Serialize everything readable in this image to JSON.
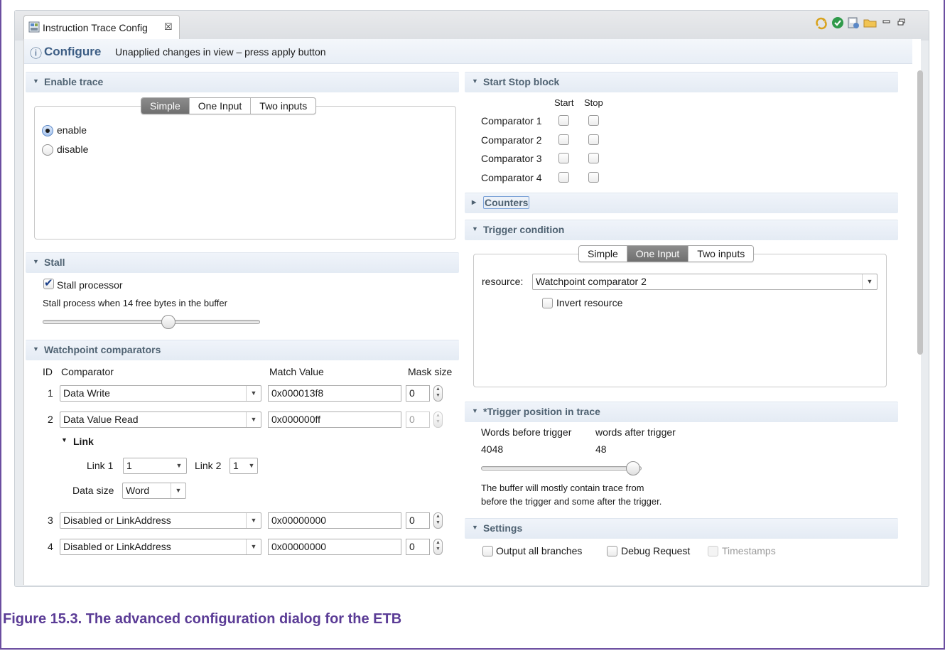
{
  "tab": {
    "title": "Instruction Trace Config",
    "close": "☒"
  },
  "toolbar_icons": [
    "refresh-icon",
    "apply-check-icon",
    "save-icon",
    "open-folder-icon",
    "minimize-icon",
    "maximize-icon"
  ],
  "infobar": {
    "icon": "ⓘ",
    "title": "Configure",
    "message": "Unapplied changes in view – press apply button"
  },
  "enable_trace": {
    "header": "Enable trace",
    "modes": [
      "Simple",
      "One Input",
      "Two inputs"
    ],
    "selected_mode": "Simple",
    "options": [
      "enable",
      "disable"
    ],
    "selected": "enable"
  },
  "stall": {
    "header": "Stall",
    "checkbox_label": "Stall processor",
    "checked": true,
    "description": "Stall process when 14 free bytes in the buffer",
    "slider_fraction": 0.58
  },
  "watchpoints": {
    "header": "Watchpoint comparators",
    "columns": {
      "id": "ID",
      "comparator": "Comparator",
      "match": "Match Value",
      "mask": "Mask size"
    },
    "rows": [
      {
        "id": "1",
        "comparator": "Data Write",
        "match": "0x000013f8",
        "mask": "0",
        "enabled": true
      },
      {
        "id": "2",
        "comparator": "Data Value Read",
        "match": "0x000000ff",
        "mask": "0",
        "enabled": false
      },
      {
        "id": "3",
        "comparator": "Disabled or LinkAddress",
        "match": "0x00000000",
        "mask": "0",
        "enabled": true
      },
      {
        "id": "4",
        "comparator": "Disabled or LinkAddress",
        "match": "0x00000000",
        "mask": "0",
        "enabled": true
      }
    ],
    "link": {
      "header": "Link",
      "link1_label": "Link 1",
      "link1_value": "1",
      "link2_label": "Link 2",
      "link2_value": "1",
      "data_size_label": "Data size",
      "data_size_value": "Word"
    }
  },
  "start_stop": {
    "header": "Start Stop block",
    "col_start": "Start",
    "col_stop": "Stop",
    "rows": [
      "Comparator 1",
      "Comparator 2",
      "Comparator 3",
      "Comparator 4"
    ]
  },
  "counters": {
    "header": "Counters"
  },
  "trigger": {
    "header": "Trigger condition",
    "modes": [
      "Simple",
      "One Input",
      "Two inputs"
    ],
    "selected_mode": "One Input",
    "resource_label": "resource:",
    "resource_value": "Watchpoint comparator 2",
    "invert_label": "Invert resource"
  },
  "trigger_position": {
    "header": "*Trigger position in trace",
    "before_label": "Words before trigger",
    "after_label": "words after trigger",
    "before_value": "4048",
    "after_value": "48",
    "slider_fraction": 0.95,
    "note_line1": "The buffer will mostly contain trace from",
    "note_line2": "before the trigger and some after the trigger."
  },
  "settings": {
    "header": "Settings",
    "output_all_branches": "Output all branches",
    "debug_request": "Debug Request",
    "timestamps": "Timestamps"
  },
  "caption": "Figure 15.3. The advanced configuration dialog for the ETB"
}
